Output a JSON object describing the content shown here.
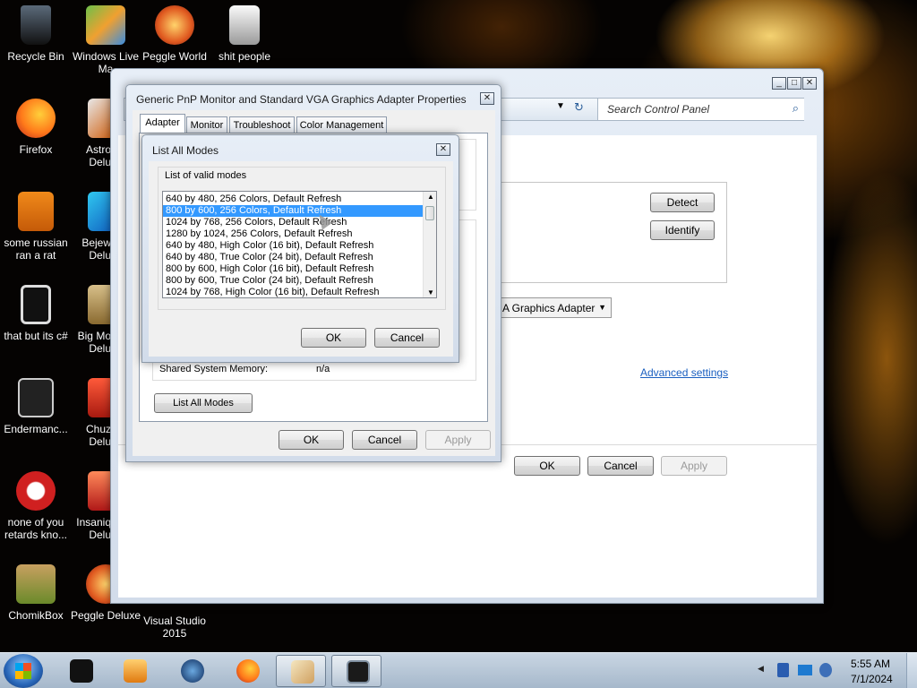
{
  "desktop": {
    "icons": [
      {
        "label": "Recycle Bin",
        "icon": "recycle-bin-icon"
      },
      {
        "label": "Windows Live Ma",
        "icon": "windows-live-icon"
      },
      {
        "label": "Peggle World",
        "icon": "peggle-icon"
      },
      {
        "label": "shit people",
        "icon": "folder-icon"
      },
      {
        "label": "Firefox",
        "icon": "firefox-icon"
      },
      {
        "label": "Astro Delu",
        "icon": "astro-icon"
      },
      {
        "label": "some russian ran a rat",
        "icon": "file-icon"
      },
      {
        "label": "Bejew Delu",
        "icon": "bejeweled-icon"
      },
      {
        "label": "that but its c#",
        "icon": "shortcut-icon"
      },
      {
        "label": "Big Mo Delu",
        "icon": "game-icon"
      },
      {
        "label": "Endermanc...",
        "icon": "app-icon"
      },
      {
        "label": "Chuz Delu",
        "icon": "game-icon"
      },
      {
        "label": "none of you retards kno...",
        "icon": "app-icon"
      },
      {
        "label": "Insaniq Delu",
        "icon": "game-icon"
      },
      {
        "label": "ChomikBox",
        "icon": "chomikbox-icon"
      },
      {
        "label": "Peggle Deluxe",
        "icon": "peggle-icon"
      },
      {
        "label": "Visual Studio 2015",
        "icon": "visual-studio-icon"
      }
    ]
  },
  "control_panel": {
    "search_placeholder": "Search Control Panel",
    "detect": "Detect",
    "identify": "Identify",
    "adapter_dropdown": "A Graphics Adapter",
    "advanced_link": "Advanced settings",
    "ok": "OK",
    "cancel": "Cancel",
    "apply": "Apply"
  },
  "properties": {
    "title": "Generic PnP Monitor and Standard VGA Graphics Adapter Properties",
    "tabs": [
      "Adapter",
      "Monitor",
      "Troubleshoot",
      "Color Management"
    ],
    "shared_memory_label": "Shared System Memory:",
    "shared_memory_value": "n/a",
    "list_all_modes": "List All Modes",
    "ok": "OK",
    "cancel": "Cancel",
    "apply": "Apply"
  },
  "modes_dialog": {
    "title": "List All Modes",
    "group_label": "List of valid modes",
    "modes": [
      "640 by 480, 256 Colors, Default Refresh",
      "800 by 600, 256 Colors, Default Refresh",
      "1024 by 768, 256 Colors, Default Refresh",
      "1280 by 1024, 256 Colors, Default Refresh",
      "640 by 480, High Color (16 bit), Default Refresh",
      "640 by 480, True Color (24 bit), Default Refresh",
      "800 by 600, High Color (16 bit), Default Refresh",
      "800 by 600, True Color (24 bit), Default Refresh",
      "1024 by 768, High Color (16 bit), Default Refresh"
    ],
    "selected_index": 1,
    "ok": "OK",
    "cancel": "Cancel"
  },
  "taskbar": {
    "time": "5:55 AM",
    "date": "7/1/2024"
  }
}
